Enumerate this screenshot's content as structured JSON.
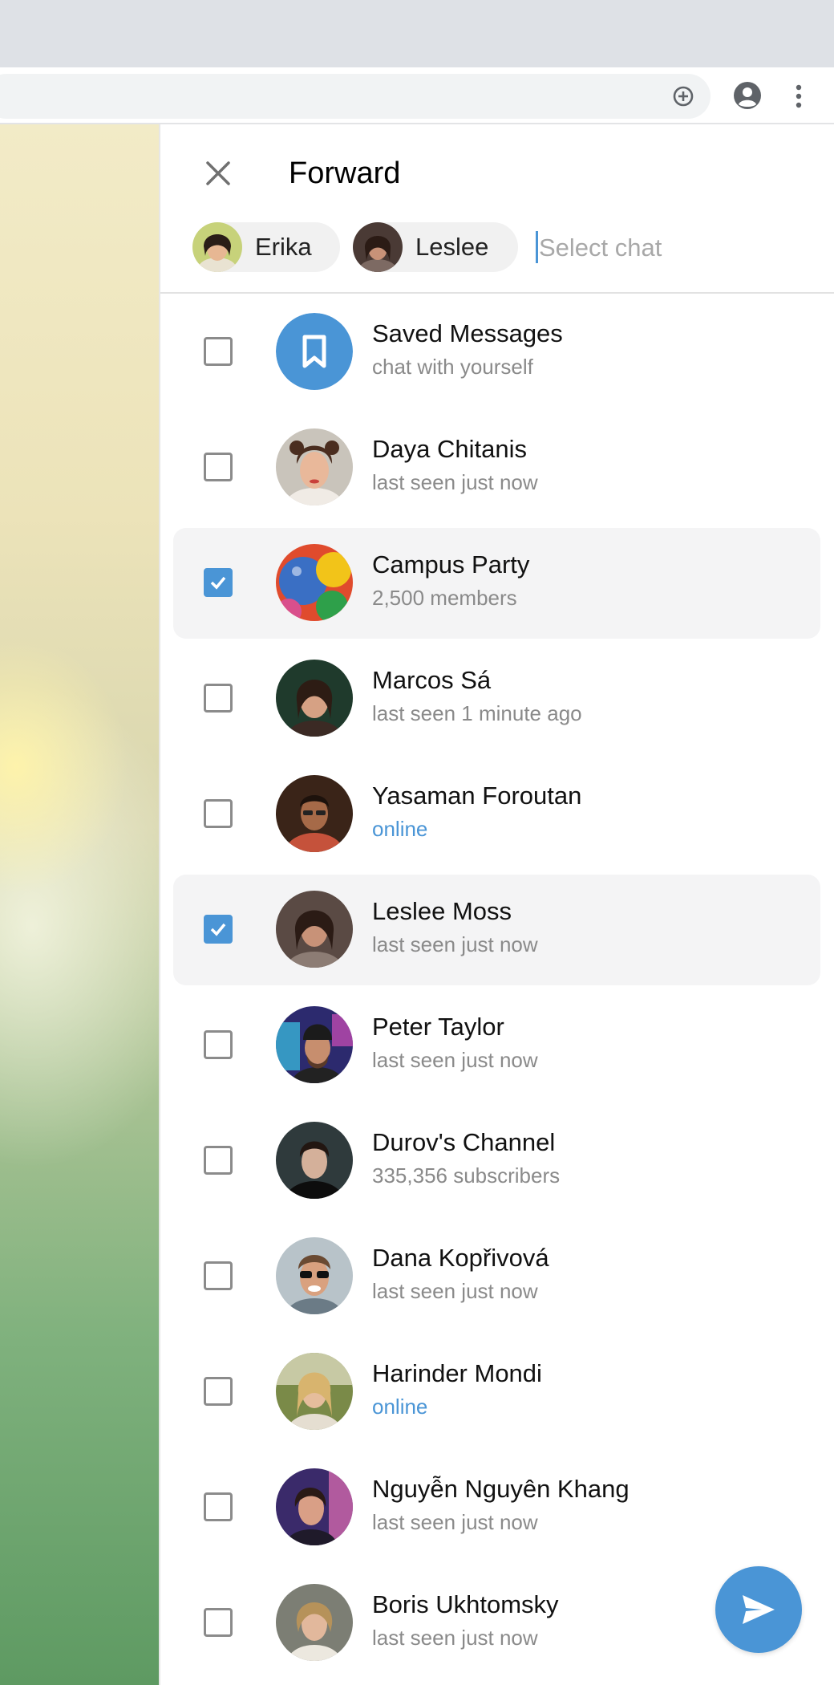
{
  "panel": {
    "title": "Forward",
    "search_placeholder": "Select chat",
    "chips": [
      {
        "label": "Erika"
      },
      {
        "label": "Leslee"
      }
    ]
  },
  "chats": [
    {
      "name": "Saved Messages",
      "status": "chat with yourself",
      "checked": false,
      "avatar": "bookmark-icon"
    },
    {
      "name": "Daya Chitanis",
      "status": "last seen just now",
      "checked": false
    },
    {
      "name": "Campus Party",
      "status": "2,500 members",
      "checked": true
    },
    {
      "name": "Marcos Sá",
      "status": "last seen 1 minute ago",
      "checked": false
    },
    {
      "name": "Yasaman Foroutan",
      "status": "online",
      "checked": false
    },
    {
      "name": "Leslee Moss",
      "status": "last seen just now",
      "checked": true
    },
    {
      "name": "Peter Taylor",
      "status": "last seen just now",
      "checked": false
    },
    {
      "name": "Durov's Channel",
      "status": "335,356 subscribers",
      "checked": false
    },
    {
      "name": "Dana Kopřivová",
      "status": "last seen just now",
      "checked": false
    },
    {
      "name": "Harinder Mondi",
      "status": "online",
      "checked": false
    },
    {
      "name": "Nguyễn Nguyên Khang",
      "status": "last seen just now",
      "checked": false
    },
    {
      "name": "Boris Ukhtomsky",
      "status": "last seen just now",
      "checked": false
    }
  ],
  "colors": {
    "accent": "#4a95d6",
    "online": "#4a95d6",
    "highlight_row": "#f4f4f5"
  }
}
